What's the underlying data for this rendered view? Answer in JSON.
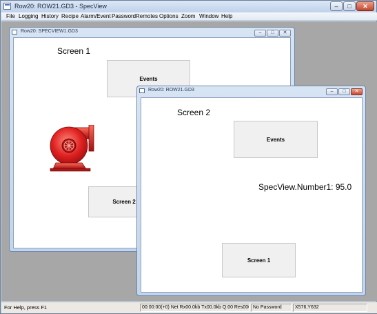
{
  "app": {
    "title": "Row20: ROW21.GD3 - SpecView"
  },
  "caption_buttons": {
    "minimize": "–",
    "maximize": "□",
    "close": "✕"
  },
  "menu": [
    "File",
    "Logging",
    "History",
    "Recipe",
    "Alarm/Event",
    "Password",
    "Remotes",
    "Options",
    "Zoom",
    "Window",
    "Help"
  ],
  "window1": {
    "title": "Row20: SPECVIEW1.GD3",
    "screen_label": "Screen 1",
    "events_button": "Events",
    "nav_button": "Screen 2",
    "pump_icon": "centrifugal-pump-icon"
  },
  "window2": {
    "title": "Row20: ROW21.GD3",
    "screen_label": "Screen 2",
    "events_button": "Events",
    "value_text": "SpecView.Number1: 95.0",
    "nav_button": "Screen 1"
  },
  "status": {
    "help": "For Help, press F1",
    "network": "00:00:00(+0) Net Rx00.0kb Tx00.0kb Q:00 Res000.00",
    "password": "No Password",
    "coords": "X576,Y632"
  },
  "colors": {
    "pump": "#e02020",
    "mdi_background": "#a7a7a7"
  }
}
